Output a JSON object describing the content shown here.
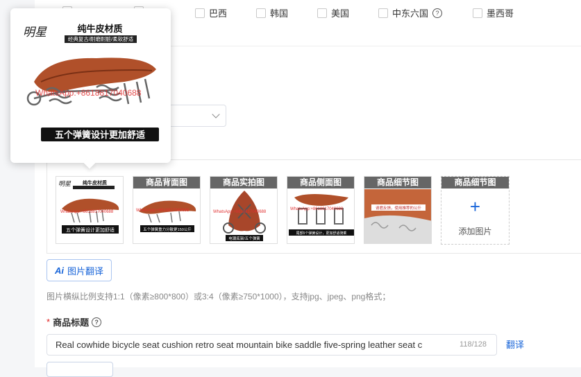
{
  "countries": [
    {
      "label": "巴西"
    },
    {
      "label": "韩国"
    },
    {
      "label": "美国"
    },
    {
      "label": "中东六国"
    },
    {
      "label": "墨西哥"
    }
  ],
  "popup": {
    "brand": "明星",
    "title": "纯牛皮材质",
    "subtitle": "经典复古/耐磨耐脏/柔软舒适",
    "watermark": "WhatsApp:+8618817040688",
    "footer": "五个弹簧设计更加舒适"
  },
  "images": [
    {
      "caption": "",
      "footer": "五个弹簧设计更加舒适"
    },
    {
      "caption": "商品背面图",
      "footer": "五个弹簧重力分散更150公斤"
    },
    {
      "caption": "商品实拍图",
      "footer": "电镀底架/五个弹簧"
    },
    {
      "caption": "商品侧面图",
      "footer": "尾部5个弹簧设计，更加舒适骑乘"
    },
    {
      "caption": "商品细节图",
      "footer": "请君反馈，使用推荐的公斤"
    }
  ],
  "add_image": {
    "caption": "商品细节图",
    "label": "添加图片"
  },
  "translate_button": {
    "icon": "Ai",
    "label": "图片翻译"
  },
  "hint": "图片横纵比例支持1:1（像素≥800*800）或3:4（像素≥750*1000），支持jpg、jpeg、png格式；",
  "title_field": {
    "label": "商品标题",
    "required": "*",
    "value": "Real cowhide bicycle seat cushion retro seat mountain bike saddle five-spring leather seat c",
    "count": "118/128",
    "translate": "翻译"
  },
  "colors": {
    "accent": "#1a66d9",
    "saddle": "#b0502a",
    "required": "#e02020"
  }
}
